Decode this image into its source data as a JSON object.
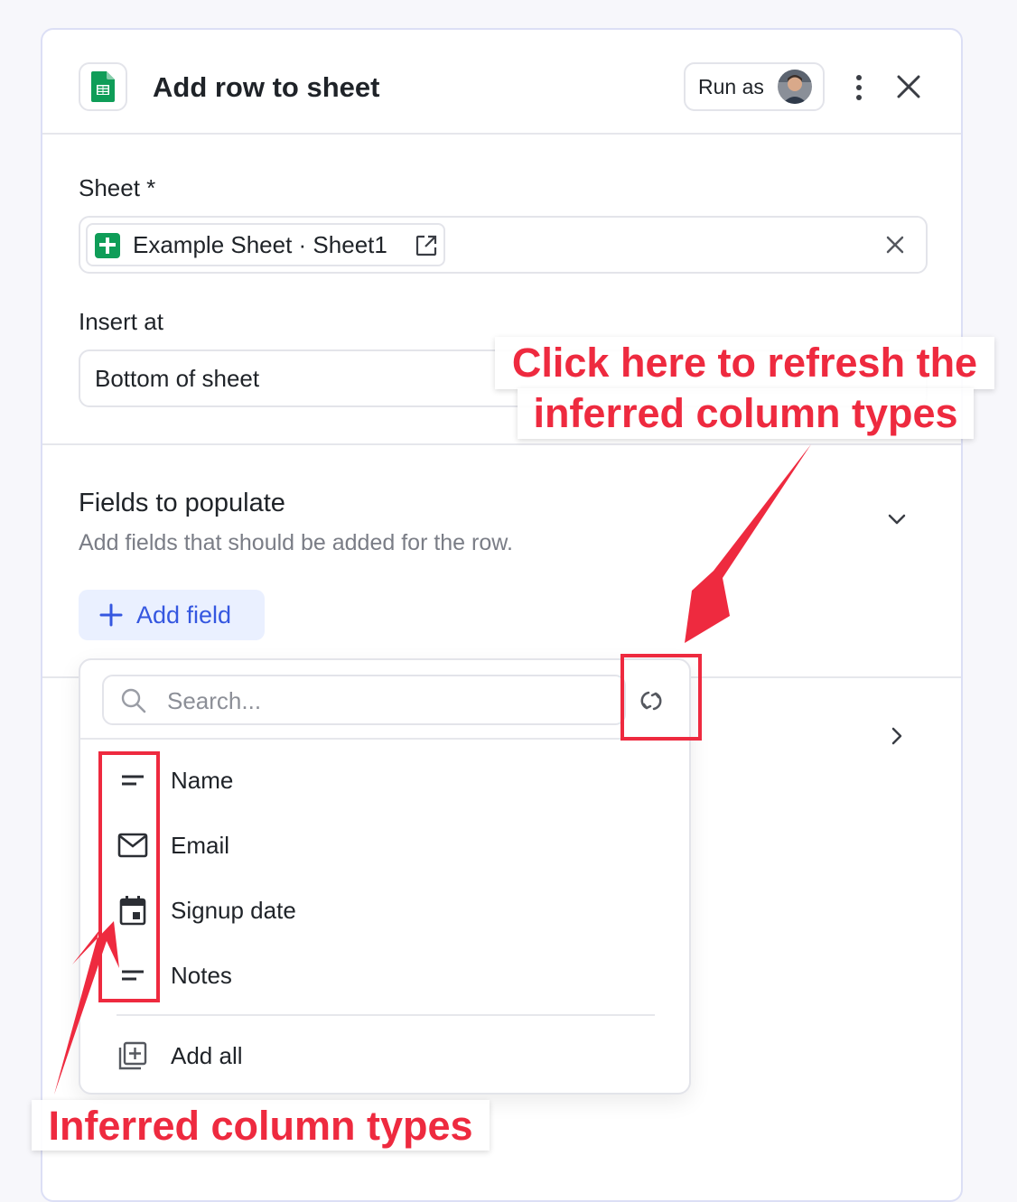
{
  "header": {
    "title": "Add row to sheet",
    "run_as_label": "Run as"
  },
  "sheet": {
    "label": "Sheet *",
    "value": "Example Sheet · Sheet1"
  },
  "insert_at": {
    "label": "Insert at",
    "value": "Bottom of sheet"
  },
  "fields": {
    "title": "Fields to populate",
    "subtitle": "Add fields that should be added for the row.",
    "add_field_label": "Add field"
  },
  "dropdown": {
    "search_placeholder": "Search...",
    "items": [
      {
        "label": "Name",
        "icon": "text-type-icon"
      },
      {
        "label": "Email",
        "icon": "email-type-icon"
      },
      {
        "label": "Signup date",
        "icon": "date-type-icon"
      },
      {
        "label": "Notes",
        "icon": "text-type-icon"
      }
    ],
    "add_all_label": "Add all"
  },
  "annotations": {
    "refresh_callout_line1": "Click here to refresh the",
    "refresh_callout_line2": "inferred column types",
    "types_callout": "Inferred column types",
    "color": "#ee2a3f"
  },
  "colors": {
    "accent": "#3557e0",
    "sheets_green": "#0f9d58"
  }
}
